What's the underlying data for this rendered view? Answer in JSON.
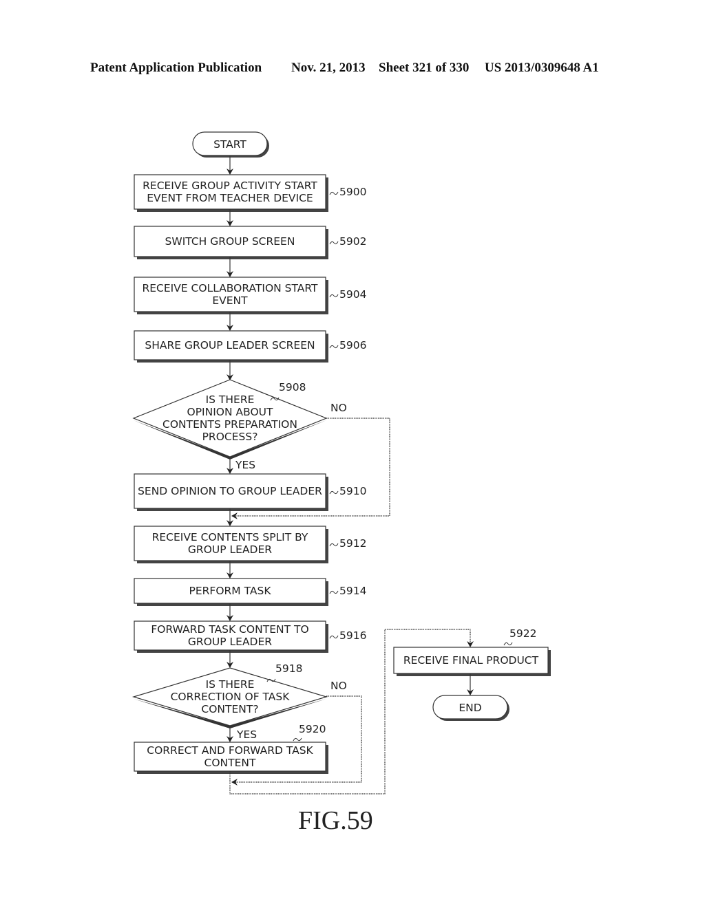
{
  "header": {
    "publication": "Patent Application Publication",
    "date": "Nov. 21, 2013",
    "sheet": "Sheet 321 of 330",
    "number": "US 2013/0309648 A1"
  },
  "figure_label": "FIG.59",
  "flowchart": {
    "start": "START",
    "end": "END",
    "steps": [
      {
        "ref": "5900",
        "lines": [
          "RECEIVE GROUP ACTIVITY START",
          "EVENT FROM TEACHER DEVICE"
        ]
      },
      {
        "ref": "5902",
        "lines": [
          "SWITCH GROUP SCREEN"
        ]
      },
      {
        "ref": "5904",
        "lines": [
          "RECEIVE COLLABORATION START",
          "EVENT"
        ]
      },
      {
        "ref": "5906",
        "lines": [
          "SHARE GROUP LEADER SCREEN"
        ]
      },
      {
        "ref": "5910",
        "lines": [
          "SEND OPINION TO GROUP LEADER"
        ]
      },
      {
        "ref": "5912",
        "lines": [
          "RECEIVE CONTENTS SPLIT BY",
          "GROUP LEADER"
        ]
      },
      {
        "ref": "5914",
        "lines": [
          "PERFORM TASK"
        ]
      },
      {
        "ref": "5916",
        "lines": [
          "FORWARD TASK CONTENT TO",
          "GROUP LEADER"
        ]
      },
      {
        "ref": "5920",
        "lines": [
          "CORRECT AND FORWARD TASK",
          "CONTENT"
        ]
      },
      {
        "ref": "5922",
        "lines": [
          "RECEIVE FINAL PRODUCT"
        ]
      }
    ],
    "decisions": [
      {
        "ref": "5908",
        "lines": [
          "IS THERE",
          "OPINION ABOUT",
          "CONTENTS PREPARATION",
          "PROCESS?"
        ],
        "yes": "YES",
        "no": "NO"
      },
      {
        "ref": "5918",
        "lines": [
          "IS THERE",
          "CORRECTION OF TASK",
          "CONTENT?"
        ],
        "yes": "YES",
        "no": "NO"
      }
    ]
  }
}
